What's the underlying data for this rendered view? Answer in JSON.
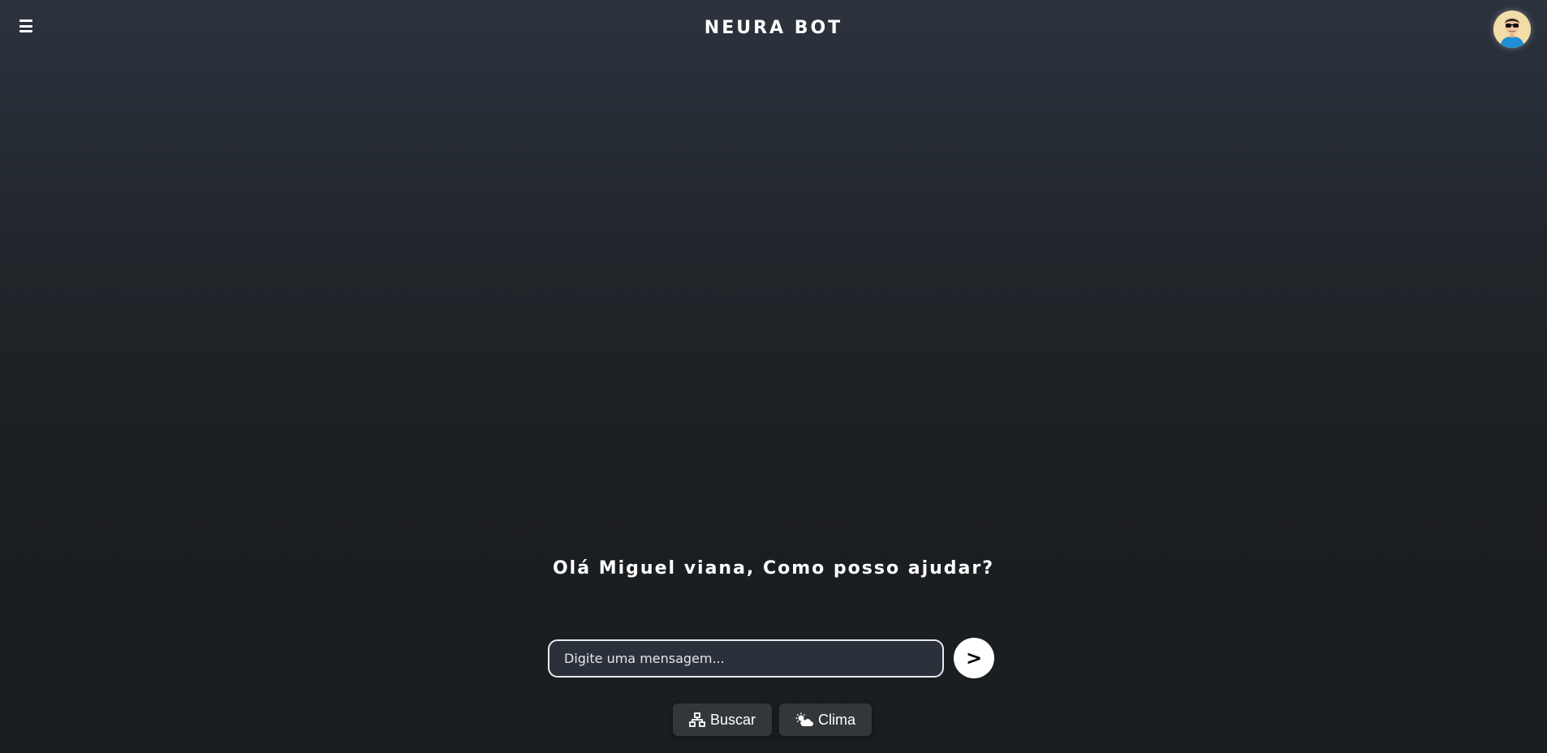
{
  "header": {
    "menu_icon": "hamburger-menu-icon",
    "title": "NEURA BOT",
    "avatar_icon": "user-avatar-icon"
  },
  "main": {
    "greeting": "Olá Miguel viana, Como posso ajudar?"
  },
  "composer": {
    "placeholder": "Digite uma mensagem...",
    "value": "",
    "send_label": ">"
  },
  "actions": {
    "search": {
      "label": "Buscar",
      "icon": "network-icon"
    },
    "weather": {
      "label": "Clima",
      "icon": "sun-cloud-icon"
    }
  },
  "colors": {
    "background_top": "#2c333e",
    "background_bottom": "#1a1d1f",
    "input_background": "#2a313b",
    "action_button_background": "#34373a",
    "text": "#ffffff"
  }
}
